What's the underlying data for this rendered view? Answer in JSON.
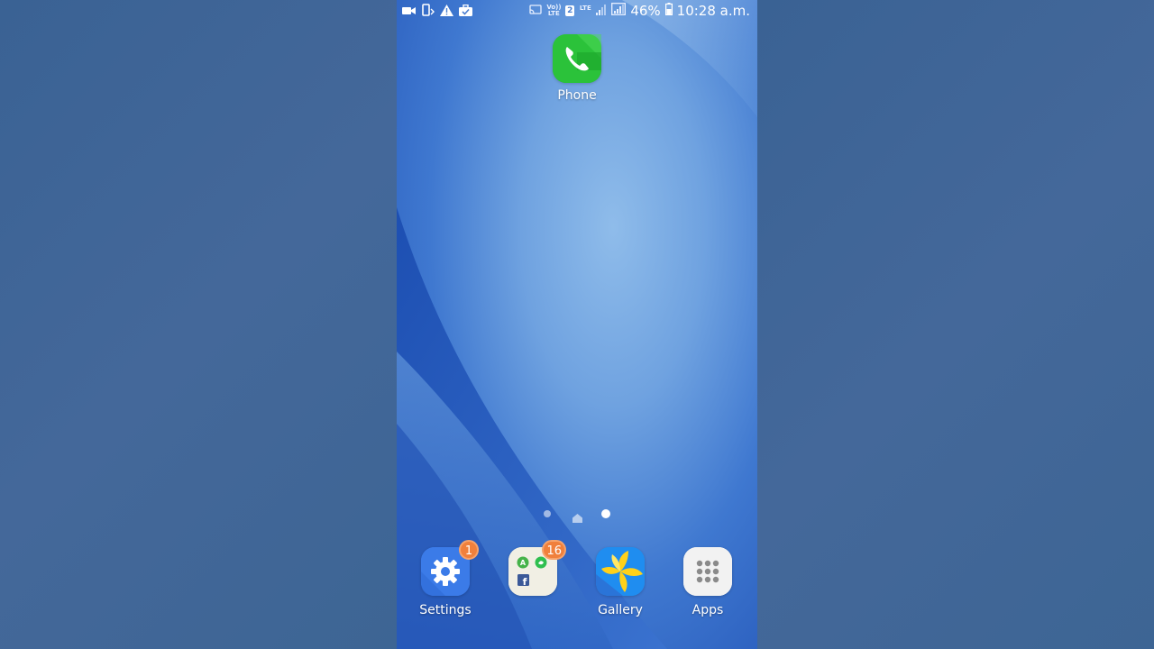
{
  "status_bar": {
    "left_icons": [
      "video-camera-icon",
      "phone-rotate-icon",
      "warning-icon",
      "briefcase-check-icon"
    ],
    "volte_label": "Vo)) LTE",
    "sim_label": "2",
    "lte_label": "LTE",
    "battery_percent": "46%",
    "time": "10:28 a.m."
  },
  "home": {
    "apps": [
      {
        "label": "Phone",
        "icon": "phone-icon",
        "color": "#2bc23a"
      }
    ],
    "page_indicator": {
      "pages": 3,
      "active_page": 2,
      "home_page": 1
    }
  },
  "dock": {
    "items": [
      {
        "label": "Settings",
        "icon": "gear-icon",
        "badge": "1",
        "color": "#3b7be8"
      },
      {
        "label": "",
        "icon": "folder-icon",
        "badge": "16",
        "color": "#f1efe4"
      },
      {
        "label": "Gallery",
        "icon": "gallery-flower-icon",
        "badge": "",
        "color": "#1f8df0"
      },
      {
        "label": "Apps",
        "icon": "apps-grid-icon",
        "badge": "",
        "color": "#f2f2f2"
      }
    ]
  },
  "colors": {
    "badge": "#f0803c",
    "wallpaper_primary": "#3f78d0",
    "background": "#3f6594"
  }
}
